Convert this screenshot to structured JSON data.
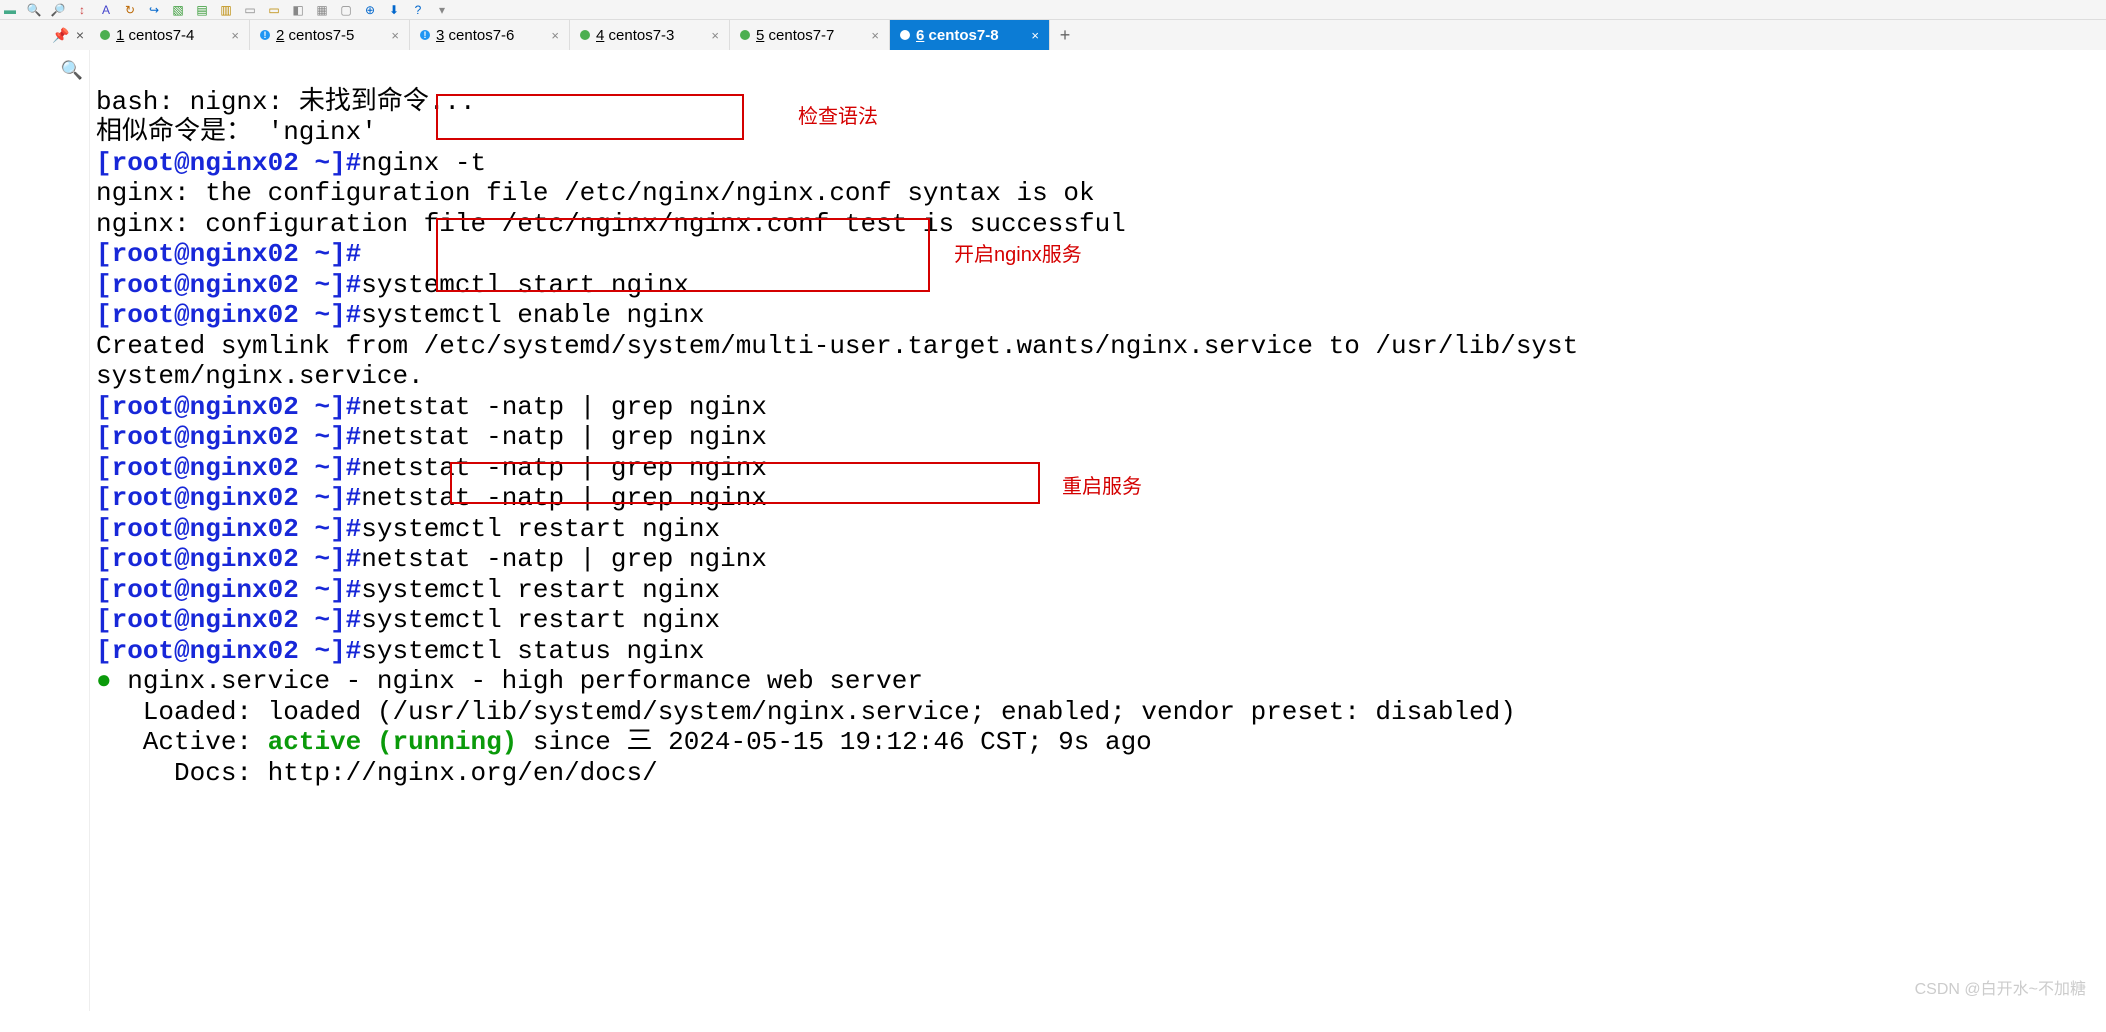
{
  "toolbar_icons": [
    "▬",
    "🔍",
    "🔎",
    "↕",
    "Aᵢ",
    "↻",
    "↪",
    "📄",
    "📑",
    "📋",
    "📁",
    "▭",
    "📂",
    "◧",
    "▦",
    "▢",
    "⊕",
    "⬇",
    "?",
    "▾"
  ],
  "side_controls": {
    "pin": "📌",
    "close": "×"
  },
  "tabs": [
    {
      "num": "1",
      "label": "centos7-4",
      "warn": false,
      "active": false
    },
    {
      "num": "2",
      "label": "centos7-5",
      "warn": true,
      "active": false
    },
    {
      "num": "3",
      "label": "centos7-6",
      "warn": true,
      "active": false
    },
    {
      "num": "4",
      "label": "centos7-3",
      "warn": false,
      "active": false
    },
    {
      "num": "5",
      "label": "centos7-7",
      "warn": false,
      "active": false
    },
    {
      "num": "6",
      "label": "centos7-8",
      "warn": false,
      "active": true
    }
  ],
  "terminal": {
    "line1": "bash: nignx: 未找到命令...",
    "line2": "相似命令是： 'nginx'",
    "prompt_user": "root@nginx02",
    "prompt_path": "~",
    "cmd_nginx_t": "nginx -t",
    "out_syntax_ok": "nginx: the configuration file /etc/nginx/nginx.conf syntax is ok",
    "out_test_ok": "nginx: configuration file /etc/nginx/nginx.conf test is successful",
    "cmd_start": "systemctl start nginx",
    "cmd_enable": "systemctl enable nginx",
    "out_symlink_a": "Created symlink from /etc/systemd/system/multi-user.target.wants/nginx.service to /usr/lib/syst",
    "out_symlink_b": "system/nginx.service.",
    "cmd_netstat": "netstat -natp | grep nginx",
    "cmd_restart": "systemctl restart nginx",
    "cmd_status": "systemctl status nginx",
    "status_head": " nginx.service - nginx - high performance web server",
    "status_loaded": "   Loaded: loaded (/usr/lib/systemd/system/nginx.service; enabled; vendor preset: disabled)",
    "status_active_pre": "   Active: ",
    "status_active_green": "active (running)",
    "status_active_post": " since 三 2024-05-15 19:12:46 CST; 9s ago",
    "status_docs": "     Docs: http://nginx.org/en/docs/"
  },
  "annotations": {
    "check_syntax": "检查语法",
    "start_service": "开启nginx服务",
    "restart_service": "重启服务"
  },
  "watermark": "CSDN @白开水~不加糖"
}
